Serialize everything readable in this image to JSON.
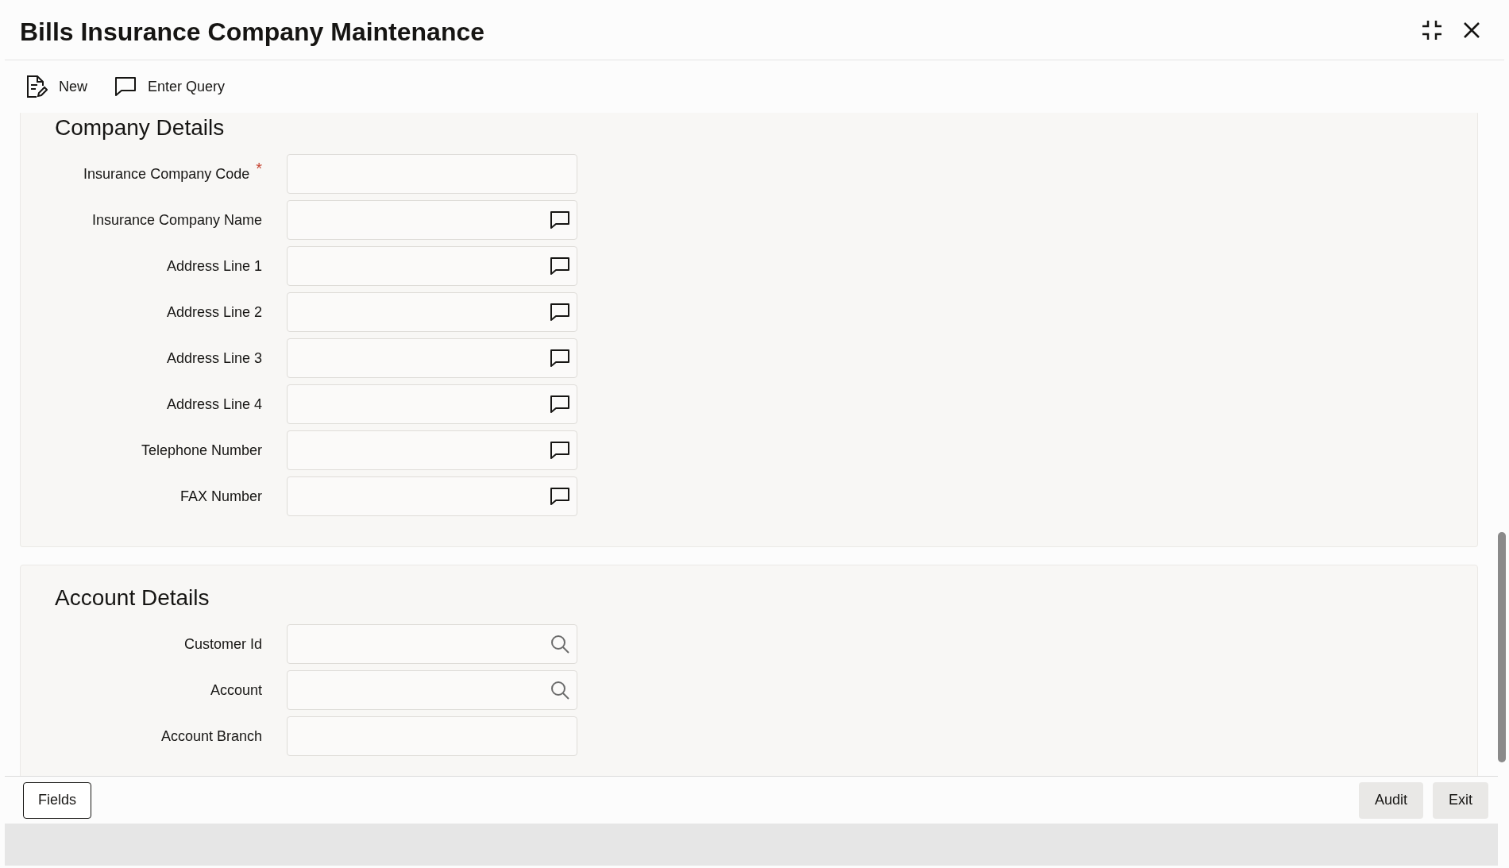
{
  "window": {
    "title": "Bills Insurance Company Maintenance"
  },
  "toolbar": [
    {
      "label": "New",
      "kind": "new"
    },
    {
      "label": "Enter Query",
      "kind": "query"
    }
  ],
  "sections": [
    {
      "title": "Company Details",
      "fields": [
        {
          "label": "Insurance Company Code",
          "required_mark": "*",
          "kind": "plain"
        },
        {
          "label": "Insurance Company Name",
          "kind": "comment"
        },
        {
          "label": "Address Line 1",
          "kind": "comment"
        },
        {
          "label": "Address Line 2",
          "kind": "comment"
        },
        {
          "label": "Address Line 3",
          "kind": "comment"
        },
        {
          "label": "Address Line 4",
          "kind": "comment"
        },
        {
          "label": "Telephone Number",
          "kind": "comment"
        },
        {
          "label": "FAX Number",
          "kind": "comment"
        }
      ]
    },
    {
      "title": "Account Details",
      "fields": [
        {
          "label": "Customer Id",
          "kind": "search"
        },
        {
          "label": "Account",
          "kind": "search"
        },
        {
          "label": "Account Branch",
          "kind": "plain"
        }
      ]
    }
  ],
  "footer": {
    "left": [
      "Fields"
    ],
    "right": [
      "Audit",
      "Exit"
    ]
  }
}
